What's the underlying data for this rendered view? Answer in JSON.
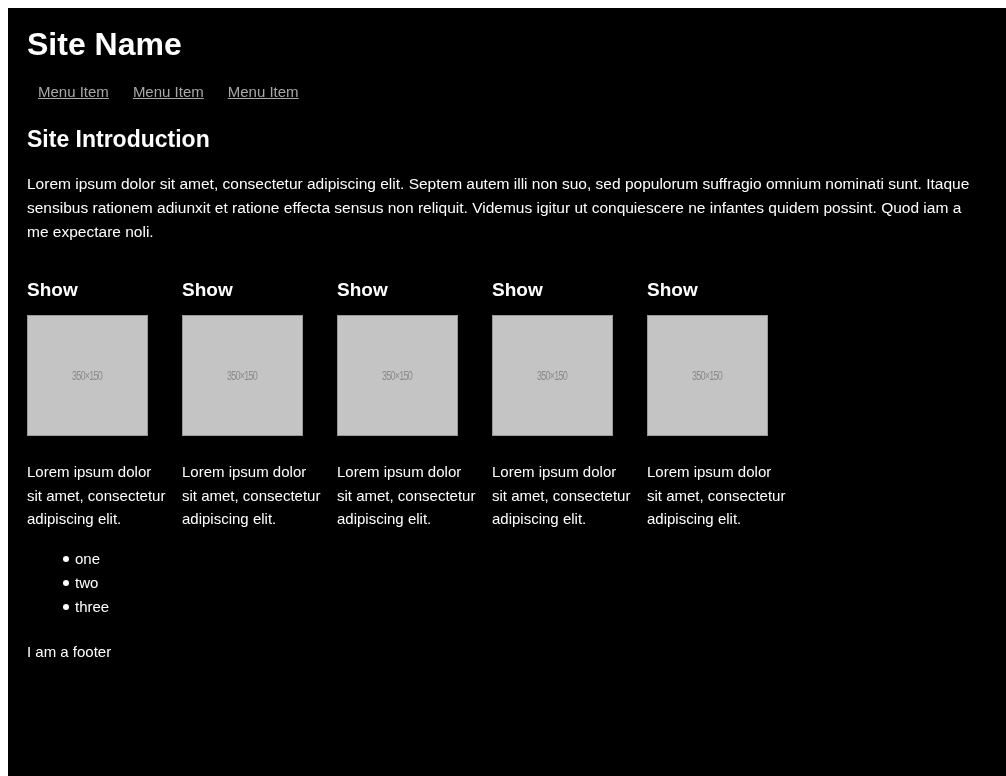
{
  "site_name": "Site Name",
  "menu": [
    {
      "label": "Menu Item"
    },
    {
      "label": "Menu Item"
    },
    {
      "label": "Menu Item"
    }
  ],
  "intro": {
    "heading": "Site Introduction",
    "text": "Lorem ipsum dolor sit amet, consectetur adipiscing elit. Septem autem illi non suo, sed populorum suffragio omnium nominati sunt. Itaque sensibus rationem adiunxit et ratione effecta sensus non reliquit. Videmus igitur ut conquiescere ne infantes quidem possint. Quod iam a me expectare noli."
  },
  "shows": [
    {
      "title": "Show",
      "placeholder": "350×150",
      "text": "Lorem ipsum dolor sit amet, consectetur adipiscing elit."
    },
    {
      "title": "Show",
      "placeholder": "350×150",
      "text": "Lorem ipsum dolor sit amet, consectetur adipiscing elit."
    },
    {
      "title": "Show",
      "placeholder": "350×150",
      "text": "Lorem ipsum dolor sit amet, consectetur adipiscing elit."
    },
    {
      "title": "Show",
      "placeholder": "350×150",
      "text": "Lorem ipsum dolor sit amet, consectetur adipiscing elit."
    },
    {
      "title": "Show",
      "placeholder": "350×150",
      "text": "Lorem ipsum dolor sit amet, consectetur adipiscing elit."
    }
  ],
  "list": [
    "one",
    "two",
    "three"
  ],
  "footer": "I am a footer"
}
